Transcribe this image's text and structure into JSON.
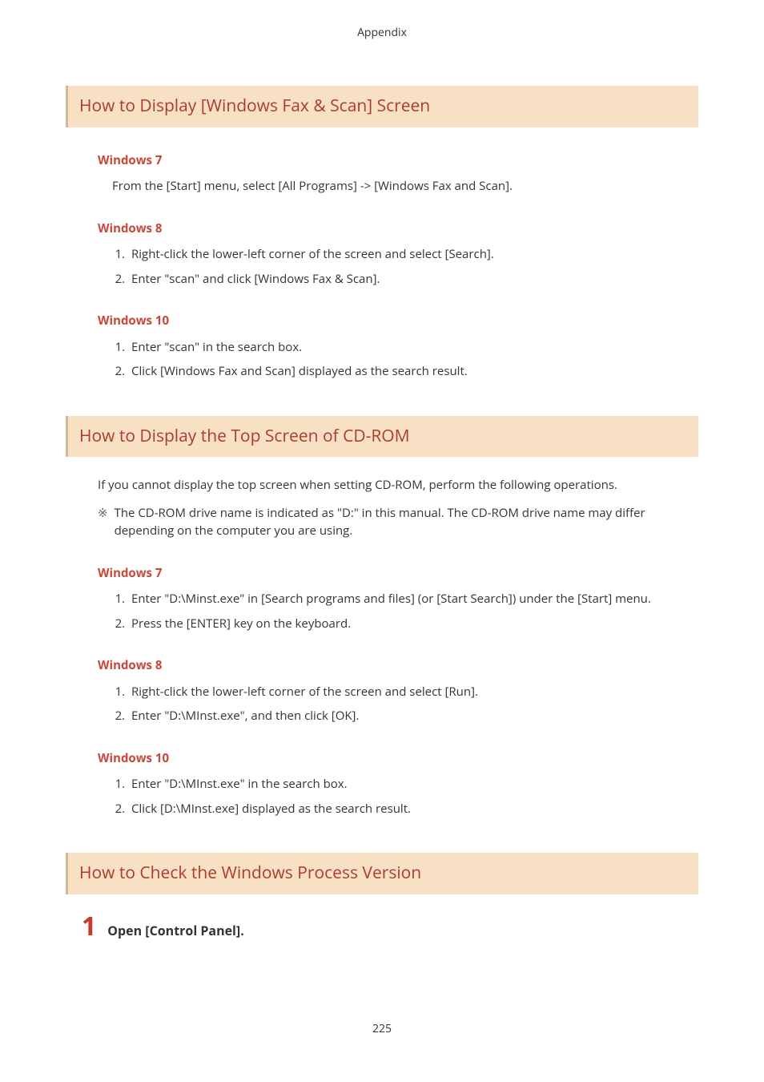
{
  "header": "Appendix",
  "sections": [
    {
      "title": "How to Display [Windows Fax & Scan] Screen",
      "blocks": [
        {
          "subtitle": "Windows 7",
          "body": "From the [Start] menu, select [All Programs] -> [Windows Fax and Scan]."
        },
        {
          "subtitle": "Windows 8",
          "steps": [
            "Right-click the lower-left corner of the screen and select [Search].",
            "Enter \"scan\" and click [Windows Fax & Scan]."
          ]
        },
        {
          "subtitle": "Windows 10",
          "steps": [
            "Enter \"scan\" in the search box.",
            "Click [Windows Fax and Scan] displayed as the search result."
          ]
        }
      ]
    },
    {
      "title": "How to Display the Top Screen of CD-ROM",
      "intro": "If you cannot display the top screen when setting CD-ROM, perform the following operations.",
      "note_marker": "※",
      "note": "The CD-ROM drive name is indicated as \"D:\" in this manual. The CD-ROM drive name may differ depending on the computer you are using.",
      "blocks": [
        {
          "subtitle": "Windows 7",
          "steps": [
            "Enter \"D:\\Minst.exe\" in [Search programs and files] (or [Start Search]) under the [Start] menu.",
            "Press the [ENTER] key on the keyboard."
          ]
        },
        {
          "subtitle": "Windows 8",
          "steps": [
            "Right-click the lower-left corner of the screen and select [Run].",
            "Enter \"D:\\MInst.exe\", and then click [OK]."
          ]
        },
        {
          "subtitle": "Windows 10",
          "steps": [
            "Enter \"D:\\MInst.exe\" in the search box.",
            "Click [D:\\MInst.exe] displayed as the search result."
          ]
        }
      ]
    },
    {
      "title": "How to Check the Windows Process Version",
      "numbered_step": {
        "number": "1",
        "label": "Open [Control Panel]."
      }
    }
  ],
  "page_number": "225"
}
